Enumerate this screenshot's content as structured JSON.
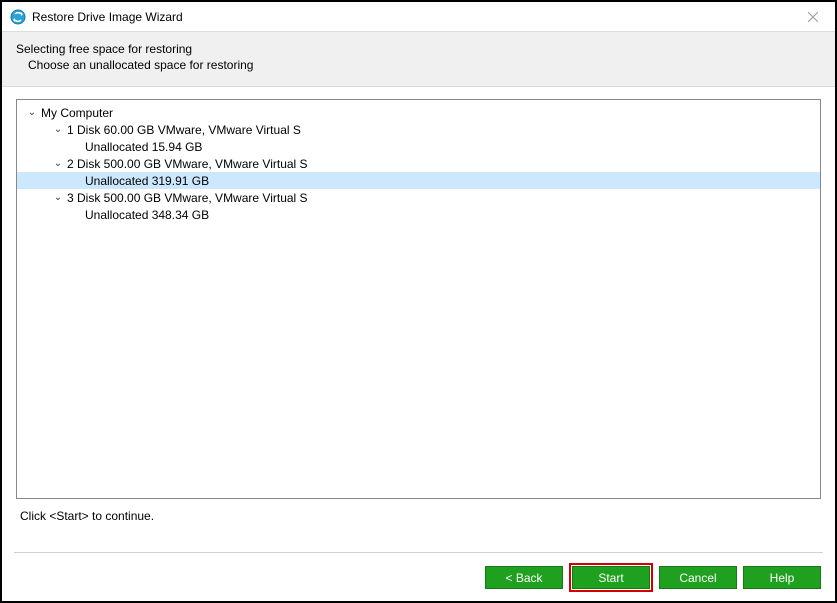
{
  "titlebar": {
    "title": "Restore Drive Image Wizard"
  },
  "header": {
    "heading": "Selecting free space for restoring",
    "subheading": "Choose an unallocated space for restoring"
  },
  "tree": {
    "root": "My Computer",
    "disks": [
      {
        "label": "1 Disk 60.00 GB VMware,  VMware Virtual S",
        "child": "Unallocated 15.94 GB",
        "selected": false
      },
      {
        "label": "2 Disk 500.00 GB VMware,  VMware Virtual S",
        "child": "Unallocated 319.91 GB",
        "selected": true
      },
      {
        "label": "3 Disk 500.00 GB VMware,  VMware Virtual S",
        "child": "Unallocated 348.34 GB",
        "selected": false
      }
    ]
  },
  "hint": "Click <Start> to continue.",
  "buttons": {
    "back": "< Back",
    "start": "Start",
    "cancel": "Cancel",
    "help": "Help"
  }
}
